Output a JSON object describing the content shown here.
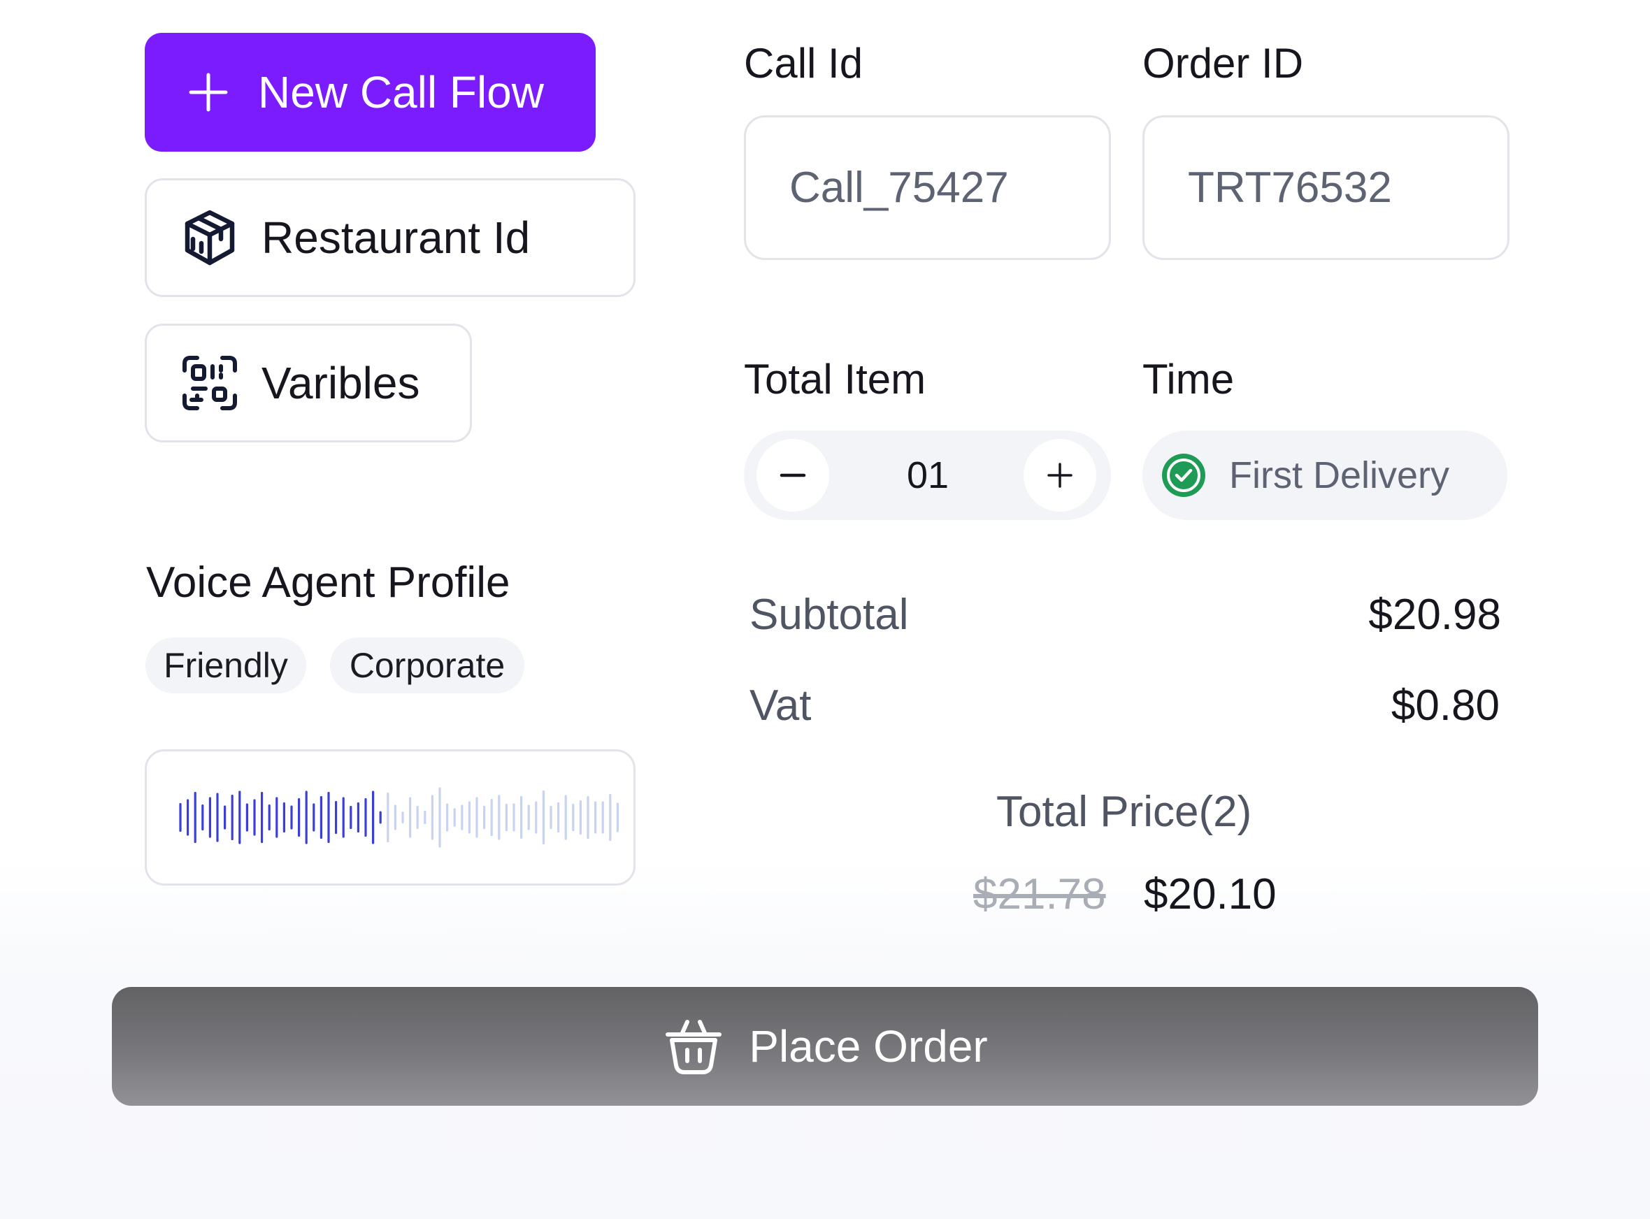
{
  "left": {
    "new_flow_label": "New Call Flow",
    "restaurant_label": "Restaurant Id",
    "variables_label": "Varibles",
    "profile": {
      "title": "Voice Agent Profile",
      "chips": [
        "Friendly",
        "Corporate"
      ]
    }
  },
  "order": {
    "call_id_label": "Call Id",
    "call_id_value": "Call_75427",
    "order_id_label": "Order ID",
    "order_id_value": "TRT76532",
    "total_item_label": "Total Item",
    "total_item_value": "01",
    "time_label": "Time",
    "time_value": "First Delivery"
  },
  "summary": {
    "subtotal_label": "Subtotal",
    "subtotal_value": "$20.98",
    "vat_label": "Vat",
    "vat_value": "$0.80",
    "total_label": "Total Price(2)",
    "old_price": "$21.78",
    "new_price": "$20.10"
  },
  "place_order_label": "Place Order",
  "icons": {
    "new_flow": "plus-icon",
    "restaurant": "box-icon",
    "variables": "qr-scan-icon",
    "stepper_minus": "minus-icon",
    "stepper_plus": "plus-icon",
    "time": "check-circle-icon",
    "place_order": "basket-icon"
  },
  "colors": {
    "accent": "#7a1cff",
    "success": "#1e9b55",
    "wave_active": "#3b3fd8",
    "wave_inactive": "#c9d2ee"
  }
}
